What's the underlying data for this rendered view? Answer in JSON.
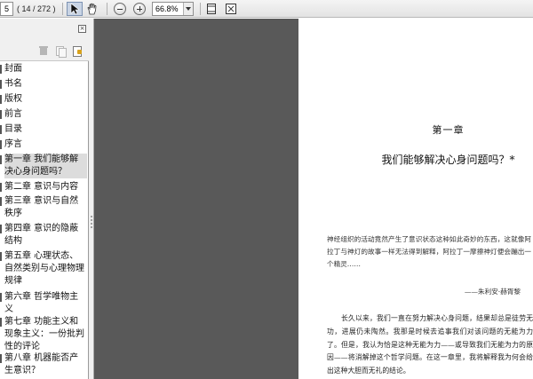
{
  "toolbar": {
    "page_number": "5",
    "page_count": "( 14 / 272 )",
    "zoom_value": "66.8%"
  },
  "sidebar": {
    "close_glyph": "×",
    "bookmarks": [
      {
        "label": "封面"
      },
      {
        "label": "书名"
      },
      {
        "label": "版权"
      },
      {
        "label": "前言"
      },
      {
        "label": "目录"
      },
      {
        "label": "序言"
      },
      {
        "label": "第一章 我们能够解决心身问题吗？",
        "selected": true
      },
      {
        "label": "第二章 意识与内容"
      },
      {
        "label": "第三章 意识与自然秩序"
      },
      {
        "label": "第四章 意识的隐蔽结构"
      },
      {
        "label": "第五章 心理状态、自然类别与心理物理规律"
      },
      {
        "label": "第六章 哲学唯物主义"
      },
      {
        "label": "第七章 功能主义和现象主义：一份批判性的评论"
      },
      {
        "label": "第八章 机器能否产生意识？"
      }
    ]
  },
  "document": {
    "chapter_label": "第一章",
    "chapter_title": "我们能够解决心身问题吗？*",
    "epigraph": "神经组织的活动竟然产生了意识状态这种如此奇妙的东西，这就像阿拉丁与神灯的故事一样无法得到解释，阿拉丁一摩擦神灯便会蹦出一个精灵……",
    "epigraph_attribution": "——朱利安·赫胥黎",
    "body": "长久以来，我们一直在努力解决心身问题，结果却总是徒劳无功，进展仍未陶然。我那是时候去追事我们对该问题的无能为力了。但是，我认为恰是这种无能为力——或导致我们无能为力的原因——将消解掉这个哲学问题。在这一章里，我将解释我为何会给出这种大胆而无礼的结论。"
  }
}
